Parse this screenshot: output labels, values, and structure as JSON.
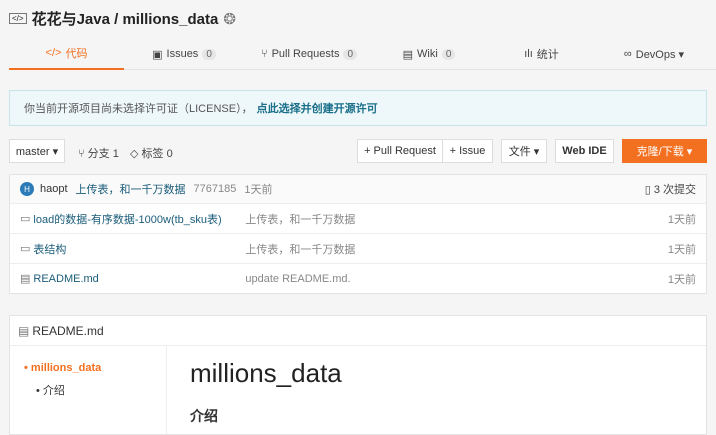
{
  "repo": {
    "title": "花花与Java / millions_data"
  },
  "tabs": [
    {
      "label": "代码",
      "icon": "code-icon"
    },
    {
      "label": "Issues",
      "count": "0"
    },
    {
      "label": "Pull Requests",
      "count": "0"
    },
    {
      "label": "Wiki",
      "count": "0"
    },
    {
      "label": "统计"
    },
    {
      "label": "DevOps ▾"
    }
  ],
  "notice": {
    "text": "你当前开源项目尚未选择许可证（LICENSE），",
    "link": "点此选择并创建开源许可"
  },
  "toolbar": {
    "branch": "master ▾",
    "branches": "分支 1",
    "tags": "标签 0",
    "pull_request": "+ Pull Request",
    "issue": "+ Issue",
    "file": "文件 ▾",
    "web_ide": "Web IDE",
    "clone": "克隆/下载 ▾"
  },
  "commit": {
    "avatar": "H",
    "author": "haopt",
    "message": "上传表，和一千万数据",
    "hash": "7767185",
    "time": "1天前",
    "count": "3 次提交"
  },
  "files": [
    {
      "name": "load的数据-有序数据-1000w(tb_sku表)",
      "message": "上传表，和一千万数据",
      "time": "1天前",
      "icon": "folder-icon"
    },
    {
      "name": "表结构",
      "message": "上传表，和一千万数据",
      "time": "1天前",
      "icon": "folder-icon"
    },
    {
      "name": "README.md",
      "message": "update README.md.",
      "time": "1天前",
      "icon": "file-icon"
    }
  ],
  "readme": {
    "header": "README.md",
    "toc": [
      "millions_data",
      "介绍"
    ],
    "h1": "millions_data",
    "h2": "介绍"
  },
  "colors": {
    "accent": "#f37021",
    "link": "#1a5c7a"
  }
}
